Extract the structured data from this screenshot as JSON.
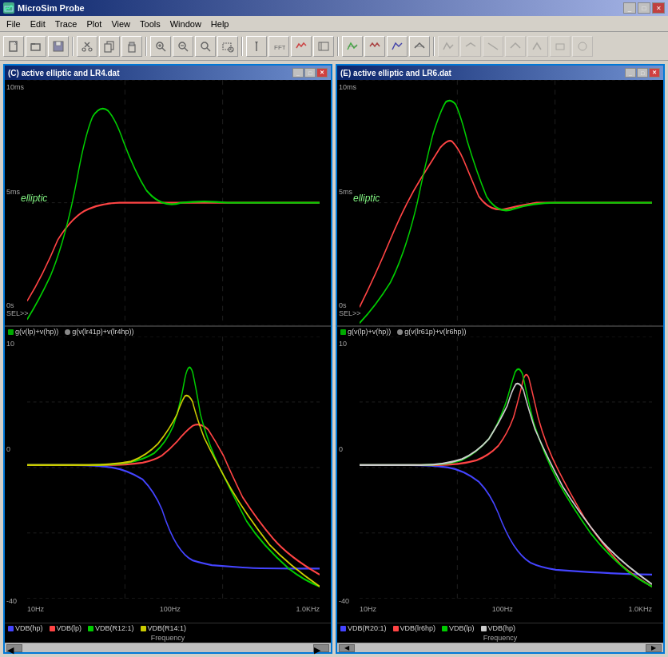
{
  "app": {
    "title": "MicroSim Probe",
    "icon": "probe-icon"
  },
  "menu": {
    "items": [
      "File",
      "Edit",
      "Trace",
      "Plot",
      "View",
      "Tools",
      "Window",
      "Help"
    ]
  },
  "toolbar": {
    "buttons": [
      "new",
      "open",
      "save",
      "cut",
      "copy",
      "paste",
      "zoom-in",
      "zoom-out",
      "zoom-fit",
      "zoom-box",
      "cursor",
      "fft",
      "measure",
      "run",
      "stop",
      "add-trace",
      "remove-trace",
      "label",
      "arrow",
      "dots",
      "waveform1",
      "waveform2",
      "waveform3",
      "waveform4",
      "waveform5",
      "waveform6",
      "waveform7",
      "waveform8",
      "waveform9",
      "waveform10"
    ]
  },
  "windows": [
    {
      "id": "window-left",
      "title": "(C) active elliptic and LR4.dat",
      "upper_plot": {
        "y_top": "10ms",
        "y_mid": "5ms",
        "y_bot": "0s",
        "sel": "SEL>>",
        "elliptic_label": "elliptic"
      },
      "lower_plot": {
        "y_top": "10",
        "y_mid": "0",
        "y_bot": "-40",
        "x_labels": [
          "10Hz",
          "100Hz",
          "1.0kHz"
        ],
        "freq_label": "Frequency"
      },
      "legend_upper": [
        {
          "color": "#00aa00",
          "text": "g(v(lp)+v(hp))"
        },
        {
          "color": "#888888",
          "text": "g(v(lr41p)+v(lr4hp))"
        }
      ],
      "legend_lower": [
        {
          "color": "#4444ff",
          "text": "VDB(hp)"
        },
        {
          "color": "#ff4444",
          "text": "VDB(lp)"
        },
        {
          "color": "#00aa00",
          "text": "VDB(R12:1)"
        },
        {
          "color": "#aaaaaa",
          "text": "VDB(R14:1)"
        }
      ]
    },
    {
      "id": "window-right",
      "title": "(E) active elliptic and LR6.dat",
      "upper_plot": {
        "y_top": "10ms",
        "y_mid": "5ms",
        "y_bot": "0s",
        "sel": "SEL>>",
        "elliptic_label": "elliptic"
      },
      "lower_plot": {
        "y_top": "10",
        "y_mid": "0",
        "y_bot": "-40",
        "x_labels": [
          "10Hz",
          "100Hz",
          "1.0kHz"
        ],
        "freq_label": "Frequency"
      },
      "legend_upper": [
        {
          "color": "#00aa00",
          "text": "g(v(lp)+v(hp))"
        },
        {
          "color": "#888888",
          "text": "g(v(lr61p)+v(lr6hp))"
        }
      ],
      "legend_lower": [
        {
          "color": "#4444ff",
          "text": "VDB(R20:1)"
        },
        {
          "color": "#ff4444",
          "text": "VDB(lr6hp)"
        },
        {
          "color": "#00aa00",
          "text": "VDB(lp)"
        },
        {
          "color": "#aaaaaa",
          "text": "VDB(hp)"
        }
      ]
    }
  ],
  "colors": {
    "title_bar_start": "#0a246a",
    "title_bar_end": "#a6b5e7",
    "background": "#d4d0c8"
  }
}
